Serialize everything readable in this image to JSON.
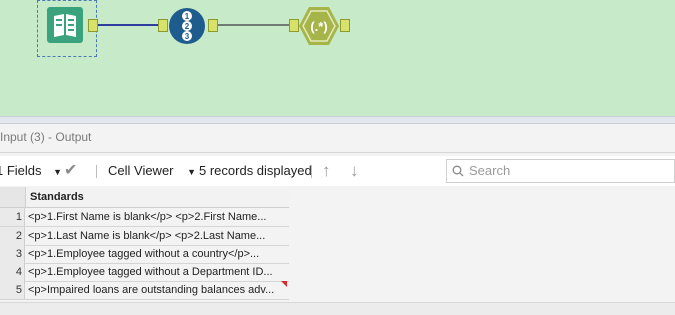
{
  "workflow": {
    "tools": [
      {
        "name": "Input (3)",
        "icon": "book-input-icon"
      },
      {
        "name": "Record ID",
        "icon": "record-id-icon",
        "glyph": [
          "1",
          "2",
          "3"
        ]
      },
      {
        "name": "RegEx",
        "icon": "regex-icon",
        "glyph": "(.*)"
      }
    ]
  },
  "results": {
    "title": "Input (3) - Output",
    "toolbar": {
      "fields_label": "1 Fields",
      "viewer_label": "Cell Viewer",
      "records_label": "5 records displayed",
      "search_placeholder": "Search"
    },
    "columns": [
      "Standards"
    ],
    "rows": [
      {
        "num": "1",
        "value": "<p>1.First Name is blank</p> <p>2.First Name..."
      },
      {
        "num": "2",
        "value": "<p>1.Last Name is blank</p> <p>2.Last Name..."
      },
      {
        "num": "3",
        "value": "<p>1.Employee tagged without a country</p>..."
      },
      {
        "num": "4",
        "value": "<p>1.Employee tagged without a Department ID..."
      },
      {
        "num": "5",
        "value": "<p>Impaired loans are outstanding balances adv..."
      }
    ]
  },
  "colors": {
    "canvas": "#c7eac8",
    "connector": "#2f3e9e",
    "record_id_tool": "#1f5c8e",
    "regex_tool": "#a5b54a",
    "anchor": "#d8e26a"
  }
}
